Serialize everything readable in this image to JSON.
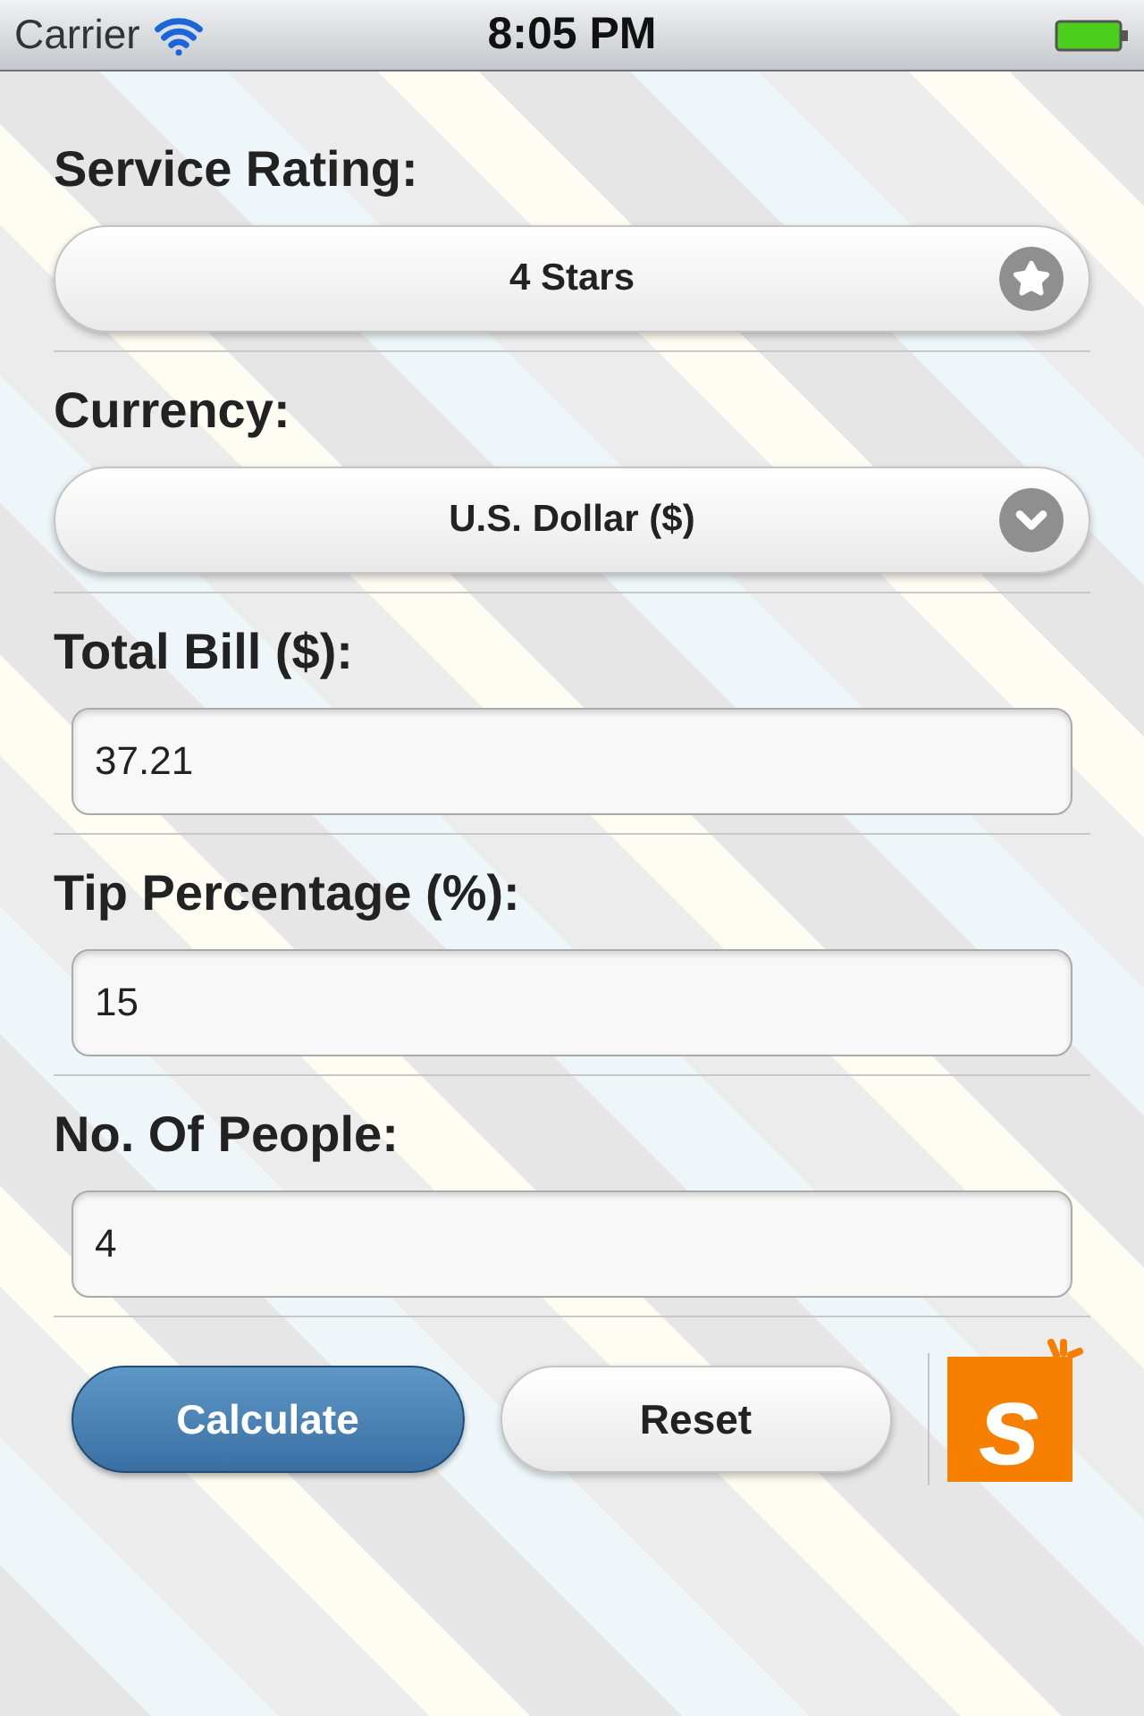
{
  "status_bar": {
    "carrier": "Carrier",
    "time": "8:05 PM"
  },
  "fields": [
    {
      "kind": "rating",
      "label": "Service Rating:",
      "value": "4 Stars"
    },
    {
      "kind": "currency",
      "label": "Currency:",
      "value": "U.S. Dollar ($)"
    },
    {
      "kind": "input",
      "label": "Total Bill ($):",
      "value": "37.21"
    },
    {
      "kind": "input",
      "label": "Tip Percentage (%):",
      "value": "15"
    },
    {
      "kind": "input",
      "label": "No. Of People:",
      "value": "4"
    }
  ],
  "buttons": [
    {
      "label": "Calculate",
      "kind": "primary"
    },
    {
      "label": "Reset",
      "kind": "secondary"
    }
  ],
  "logo": {
    "text": "s"
  }
}
